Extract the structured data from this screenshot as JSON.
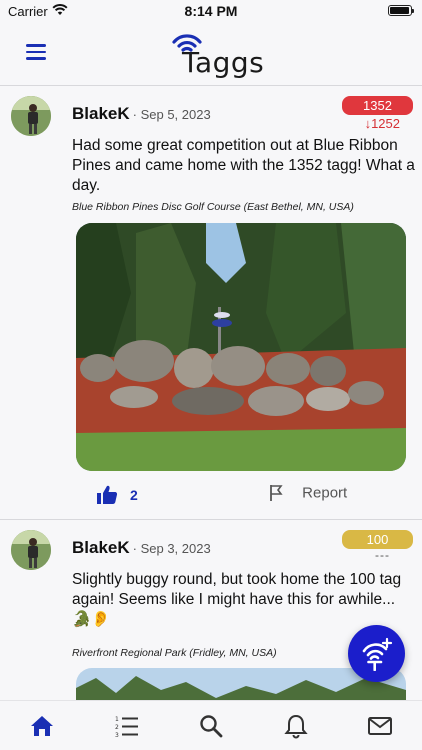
{
  "status_bar": {
    "carrier": "Carrier",
    "time": "8:14 PM"
  },
  "app": {
    "logo_text": "Taggs"
  },
  "posts": [
    {
      "username": "BlakeK",
      "date": "· Sep 5, 2023",
      "tag": "1352",
      "tag_color": "#e0373d",
      "tag_change": "↓1252",
      "text": "Had some great competition out at Blue Ribbon Pines and came home with the 1352 tagg! What a day.",
      "location": "Blue Ribbon Pines Disc Golf Course (East Bethel, MN, USA)",
      "likes": "2",
      "report_label": "Report"
    },
    {
      "username": "BlakeK",
      "date": "· Sep 3, 2023",
      "tag": "100",
      "tag_color": "#d9b845",
      "tag_change": "---",
      "text": "Slightly buggy round, but took home the 100 tag again! Seems like I might have this for awhile... 🐊👂",
      "location": "Riverfront Regional Park (Fridley, MN, USA)"
    }
  ],
  "tab_bar": {
    "items": [
      "home-icon",
      "list-icon",
      "search-icon",
      "bell-icon",
      "mail-icon"
    ],
    "active": "home-icon",
    "active_color": "#1a2fb4"
  }
}
